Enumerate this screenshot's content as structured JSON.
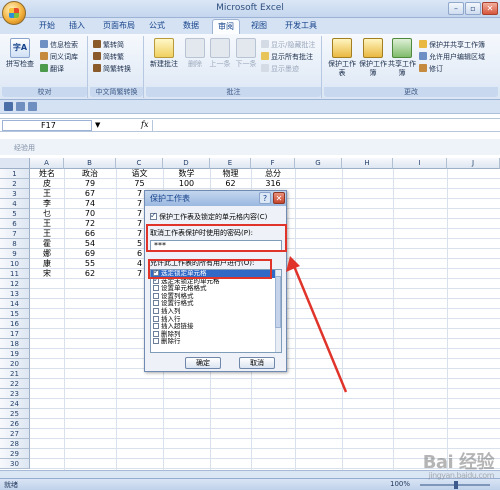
{
  "app": {
    "title": "Microsoft Excel",
    "minimize": "–",
    "restore": "▫",
    "close": "✕"
  },
  "tabs": [
    "开始",
    "插入",
    "页面布局",
    "公式",
    "数据",
    "审阅",
    "视图",
    "开发工具"
  ],
  "active_tab": "审阅",
  "ribbon": {
    "proofing": {
      "label": "校对",
      "spell": "拼写检查",
      "research": "信息检索",
      "thesaurus": "同义词库",
      "translate": "翻译"
    },
    "chinese": {
      "label": "中文简繁转换",
      "to_simplified": "繁转简",
      "to_traditional": "简转繁",
      "convert": "简繁转换"
    },
    "comments": {
      "label": "批注",
      "new": "新建批注",
      "delete": "删除",
      "prev": "上一条",
      "next": "下一条",
      "show_hide": "显示/隐藏批注",
      "show_all": "显示所有批注",
      "show_ink": "显示墨迹"
    },
    "changes": {
      "label": "更改",
      "protect_sheet": "保护工作表",
      "protect_workbook": "保护工作簿",
      "share_workbook": "共享工作簿",
      "protect_share": "保护并共享工作簿",
      "allow_edit": "允许用户编辑区域",
      "track": "修订"
    }
  },
  "formula_bar": {
    "name_box": "F17",
    "fx": "fx",
    "value": ""
  },
  "compat_label": "经验用",
  "columns": [
    "A",
    "B",
    "C",
    "D",
    "E",
    "F",
    "G",
    "H",
    "I",
    "J"
  ],
  "rows": [
    "1",
    "2",
    "3",
    "4",
    "5",
    "6",
    "7",
    "8",
    "9",
    "10",
    "11",
    "12",
    "13",
    "14",
    "15",
    "16",
    "17",
    "18",
    "19",
    "20",
    "21",
    "22",
    "23",
    "24",
    "25",
    "26",
    "27",
    "28",
    "29",
    "30"
  ],
  "table": {
    "header": [
      "姓名",
      "政治",
      "语文",
      "数学",
      "物理",
      "总分"
    ],
    "rows": [
      [
        "皮",
        "79",
        "75",
        "100",
        "62",
        "316"
      ],
      [
        "王",
        "67",
        "7",
        "",
        "",
        ""
      ],
      [
        "李",
        "74",
        "7",
        "",
        "",
        ""
      ],
      [
        "乜",
        "70",
        "7",
        "",
        "",
        ""
      ],
      [
        "王",
        "72",
        "7",
        "",
        "",
        ""
      ],
      [
        "王",
        "66",
        "7",
        "",
        "",
        ""
      ],
      [
        "霍",
        "54",
        "5",
        "",
        "",
        ""
      ],
      [
        "娜",
        "69",
        "6",
        "",
        "",
        ""
      ],
      [
        "康",
        "55",
        "4",
        "",
        "",
        ""
      ],
      [
        "宋",
        "62",
        "7",
        "",
        "",
        ""
      ]
    ]
  },
  "dialog": {
    "title": "保护工作表",
    "help": "?",
    "close": "✕",
    "protect_contents": "保护工作表及锁定的单元格内容(C)",
    "password_label": "取消工作表保护时使用的密码(P):",
    "password_value": "***",
    "allow_label": "允许此工作表的所有用户进行(O):",
    "permissions": [
      {
        "label": "选定锁定单元格",
        "checked": true
      },
      {
        "label": "选定未锁定的单元格",
        "checked": true
      },
      {
        "label": "设置单元格格式",
        "checked": false
      },
      {
        "label": "设置列格式",
        "checked": false
      },
      {
        "label": "设置行格式",
        "checked": false
      },
      {
        "label": "插入列",
        "checked": false
      },
      {
        "label": "插入行",
        "checked": false
      },
      {
        "label": "插入超链接",
        "checked": false
      },
      {
        "label": "删除列",
        "checked": false
      },
      {
        "label": "删除行",
        "checked": false
      }
    ],
    "ok": "确定",
    "cancel": "取消"
  },
  "status": {
    "ready": "就绪",
    "zoom": "100%"
  },
  "watermark": {
    "main": "Bai 经验",
    "sub": "jingyan.baidu.com"
  },
  "colors": {
    "ribbon_blue": "#dbe6f4",
    "selection": "#3169c6",
    "annotation_red": "#e0342b"
  }
}
